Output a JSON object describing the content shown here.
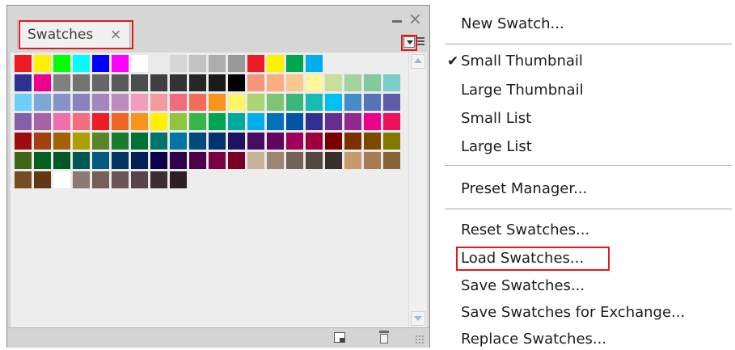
{
  "panel": {
    "tab_label": "Swatches",
    "tab_close": "×",
    "close_glyph": "×",
    "swatch_rows": [
      [
        "#ed1c24",
        "#fff200",
        "#00ff00",
        "#00ffff",
        "#0000ff",
        "#ff00ff",
        "#ffffff",
        "#ebebeb",
        "#d6d6d6",
        "#c2c2c2",
        "#adadad",
        "#999999",
        "#ed1c24",
        "#fff200",
        "#00a651",
        "#00aeef"
      ],
      [
        "#2e3192",
        "#ec008c",
        "#808080",
        "#737373",
        "#666666",
        "#595959",
        "#4d4d4d",
        "#404040",
        "#333333",
        "#262626",
        "#1a1a1a",
        "#000000",
        "#f7977a",
        "#fbad82",
        "#fdc68c",
        "#fff799",
        "#c6df9c",
        "#a4d49d",
        "#81ca9d",
        "#7bcdc9"
      ],
      [
        "#6ccff7",
        "#7ea7d8",
        "#8493ca",
        "#8882be",
        "#a286bd",
        "#bc8cbf",
        "#f49bc1",
        "#f5999d",
        "#f16d7e",
        "#f26d55",
        "#f7941d",
        "#fff467",
        "#acd372",
        "#7dc473",
        "#39b778",
        "#16bcb4",
        "#00bff3",
        "#438ccb",
        "#5573b7",
        "#5e5ca7"
      ],
      [
        "#855fa8",
        "#a762a8",
        "#f06ea9",
        "#f26e7e",
        "#ee1d24",
        "#f16522",
        "#f7941d",
        "#fff100",
        "#8fc63d",
        "#37b44a",
        "#00a650",
        "#00a99e",
        "#00aeef",
        "#0072bc",
        "#0054a5",
        "#2f3192",
        "#652c91",
        "#91278f",
        "#ed008c",
        "#ee105a"
      ],
      [
        "#9d0a0f",
        "#a1410d",
        "#a36209",
        "#aba000",
        "#598527",
        "#197b30",
        "#007236",
        "#00736a",
        "#0076a4",
        "#004a80",
        "#003370",
        "#1d1363",
        "#450e61",
        "#62055f",
        "#9e005c",
        "#9d0039",
        "#790000",
        "#7b3000",
        "#7c4900",
        "#827a00"
      ],
      [
        "#3e6617",
        "#045f20",
        "#005824",
        "#005951",
        "#005b7e",
        "#003562",
        "#002056",
        "#0c004b",
        "#30004a",
        "#4b0048",
        "#7a0045",
        "#7a0026",
        "#c7b299",
        "#998675",
        "#736357",
        "#534741",
        "#37302d",
        "#c69c6d",
        "#a67c52",
        "#8c6239"
      ],
      [
        "#754c24",
        "#603813",
        "#ffffff",
        "#8c7b74",
        "#755f59",
        "#6b5559",
        "#584348",
        "#3c2d30",
        "#2b2124"
      ]
    ]
  },
  "menu": {
    "items": [
      {
        "label": "New Swatch...",
        "checked": false
      },
      {
        "label": "Small Thumbnail",
        "checked": true
      },
      {
        "label": "Large Thumbnail",
        "checked": false
      },
      {
        "label": "Small List",
        "checked": false
      },
      {
        "label": "Large List",
        "checked": false
      },
      {
        "label": "Preset Manager...",
        "checked": false
      },
      {
        "label": "Reset Swatches...",
        "checked": false
      },
      {
        "label": "Load Swatches...",
        "checked": false,
        "highlighted": true
      },
      {
        "label": "Save Swatches...",
        "checked": false
      },
      {
        "label": "Save Swatches for Exchange...",
        "checked": false
      },
      {
        "label": "Replace Swatches...",
        "checked": false
      }
    ],
    "check_glyph": "✔"
  },
  "colors": {
    "highlight": "#e01b1b"
  }
}
